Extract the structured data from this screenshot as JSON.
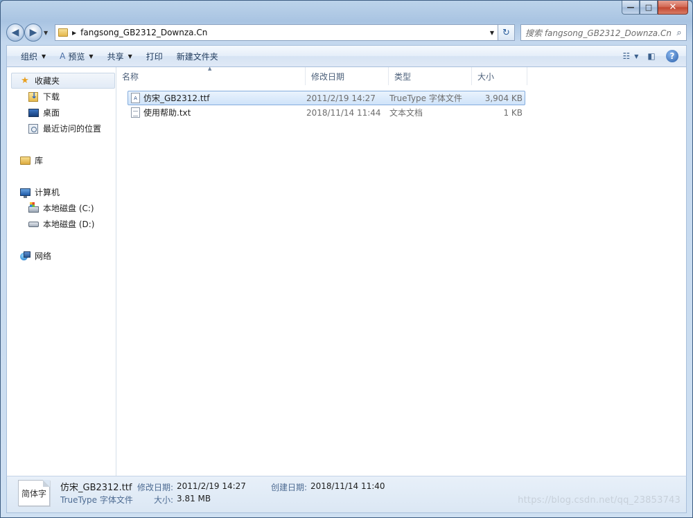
{
  "window": {
    "caption_buttons": {
      "minimize": "—",
      "maximize": "□",
      "close": "✕"
    }
  },
  "address": {
    "path": "fangsong_GB2312_Downza.Cn",
    "search_placeholder": "搜索 fangsong_GB2312_Downza.Cn"
  },
  "toolbar": {
    "organize": "组织",
    "preview": "预览",
    "share": "共享",
    "print": "打印",
    "new_folder": "新建文件夹"
  },
  "nav": {
    "favorites": "收藏夹",
    "downloads": "下载",
    "desktop": "桌面",
    "recent": "最近访问的位置",
    "libraries": "库",
    "computer": "计算机",
    "drive_c": "本地磁盘 (C:)",
    "drive_d": "本地磁盘 (D:)",
    "network": "网络"
  },
  "columns": {
    "name": "名称",
    "date": "修改日期",
    "type": "类型",
    "size": "大小"
  },
  "files": [
    {
      "name": "仿宋_GB2312.ttf",
      "date": "2011/2/19 14:27",
      "type": "TrueType 字体文件",
      "size": "3,904 KB",
      "icon": "font-file-icon",
      "selected": true
    },
    {
      "name": "使用帮助.txt",
      "date": "2018/11/14 11:44",
      "type": "文本文档",
      "size": "1 KB",
      "icon": "text-file-icon",
      "selected": false
    }
  ],
  "details": {
    "thumb_text": "简体字",
    "name": "仿宋_GB2312.ttf",
    "type": "TrueType 字体文件",
    "modified_label": "修改日期:",
    "modified_value": "2011/2/19 14:27",
    "created_label": "创建日期:",
    "created_value": "2018/11/14 11:40",
    "size_label": "大小:",
    "size_value": "3.81 MB",
    "watermark": "https://blog.csdn.net/qq_23853743"
  }
}
